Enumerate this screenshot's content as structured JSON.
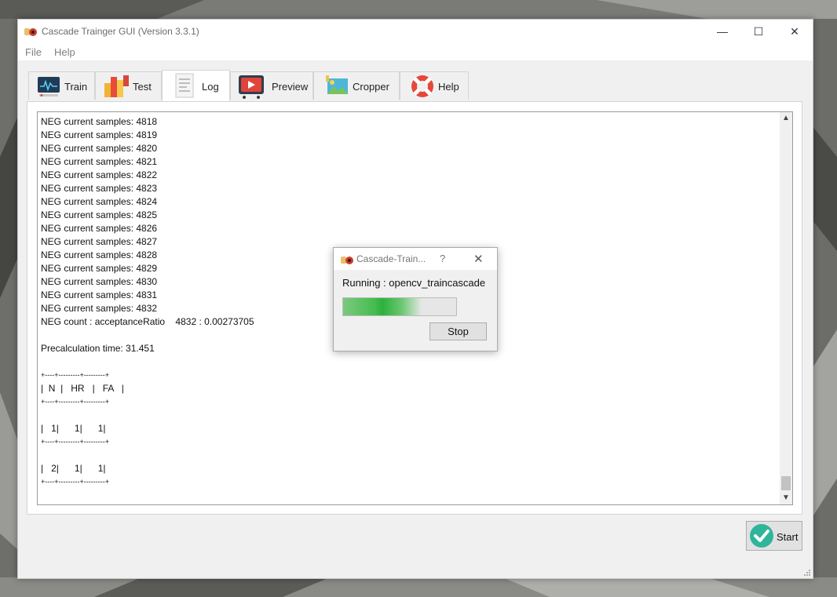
{
  "window": {
    "title": "Cascade Trainger GUI (Version 3.3.1)",
    "controls": {
      "minimize": "—",
      "maximize": "☐",
      "close": "✕"
    }
  },
  "menu": {
    "items": [
      {
        "label": "File"
      },
      {
        "label": "Help"
      }
    ]
  },
  "tabs": [
    {
      "label": "Train",
      "icon": "waveform-monitor-icon"
    },
    {
      "label": "Test",
      "icon": "colored-blocks-icon"
    },
    {
      "label": "Log",
      "icon": "document-icon",
      "active": true
    },
    {
      "label": "Preview",
      "icon": "play-video-icon"
    },
    {
      "label": "Cropper",
      "icon": "image-crop-icon"
    },
    {
      "label": "Help",
      "icon": "lifebuoy-icon"
    }
  ],
  "log": {
    "lines": [
      "NEG current samples: 4818",
      "NEG current samples: 4819",
      "NEG current samples: 4820",
      "NEG current samples: 4821",
      "NEG current samples: 4822",
      "NEG current samples: 4823",
      "NEG current samples: 4824",
      "NEG current samples: 4825",
      "NEG current samples: 4826",
      "NEG current samples: 4827",
      "NEG current samples: 4828",
      "NEG current samples: 4829",
      "NEG current samples: 4830",
      "NEG current samples: 4831",
      "NEG current samples: 4832",
      "NEG count : acceptanceRatio    4832 : 0.00273705",
      "",
      "Precalculation time: 31.451",
      "",
      "+----+---------+---------+",
      "|  N  |   HR   |   FA   |",
      "+----+---------+---------+",
      "",
      "|   1|      1|      1|",
      "+----+---------+---------+",
      "",
      "|   2|      1|      1|",
      "+----+---------+---------+"
    ]
  },
  "start_button": {
    "label": "Start"
  },
  "dialog": {
    "title": "Cascade-Train...",
    "help": "?",
    "close": "✕",
    "message": "Running : opencv_traincascade",
    "stop_label": "Stop"
  },
  "colors": {
    "accent_green": "#2db13d",
    "start_icon": "#2fb59a"
  }
}
